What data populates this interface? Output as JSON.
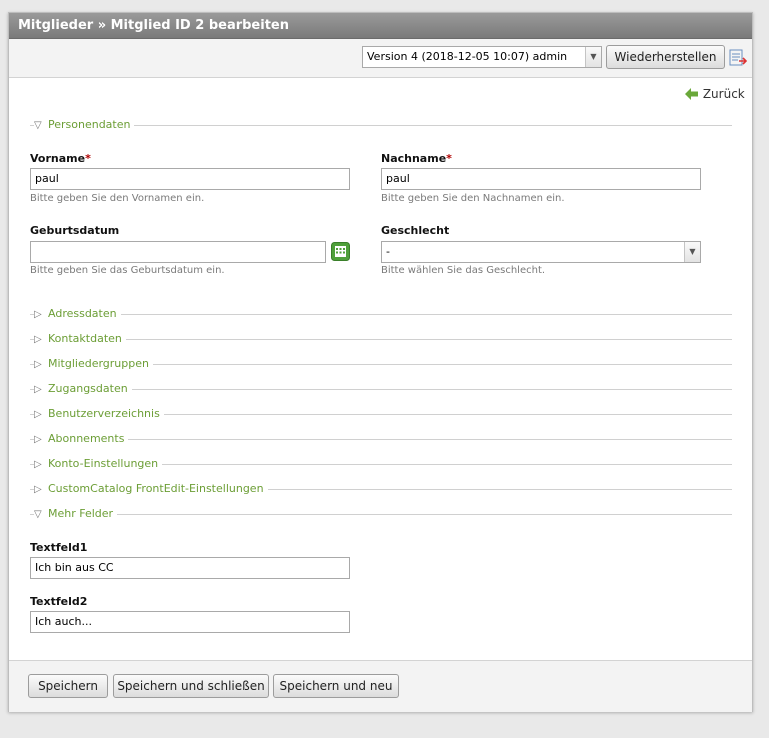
{
  "header": {
    "breadcrumb": "Mitglieder » Mitglied ID 2 bearbeiten"
  },
  "version_bar": {
    "selected_version": "Version 4 (2018-12-05 10:07) admin",
    "restore_label": "Wiederherstellen",
    "diff_icon": "compare-icon"
  },
  "back": {
    "label": "Zurück",
    "icon": "back-arrow-icon"
  },
  "personal": {
    "legend": "Personendaten",
    "firstname": {
      "label": "Vorname",
      "required": "*",
      "value": "paul",
      "hint": "Bitte geben Sie den Vornamen ein."
    },
    "lastname": {
      "label": "Nachname",
      "required": "*",
      "value": "paul",
      "hint": "Bitte geben Sie den Nachnamen ein."
    },
    "dateOfBirth": {
      "label": "Geburtsdatum",
      "value": "",
      "hint": "Bitte geben Sie das Geburtsdatum ein."
    },
    "gender": {
      "label": "Geschlecht",
      "value": "-",
      "hint": "Bitte wählen Sie das Geschlecht."
    }
  },
  "collapsed_sections": [
    "Adressdaten",
    "Kontaktdaten",
    "Mitgliedergruppen",
    "Zugangsdaten",
    "Benutzerverzeichnis",
    "Abonnements",
    "Konto-Einstellungen",
    "CustomCatalog FrontEdit-Einstellungen"
  ],
  "more_fields": {
    "legend": "Mehr Felder",
    "textfeld1": {
      "label": "Textfeld1",
      "value": "Ich bin aus CC"
    },
    "textfeld2": {
      "label": "Textfeld2",
      "value": "Ich auch..."
    }
  },
  "footer": {
    "save": "Speichern",
    "save_close": "Speichern und schließen",
    "save_new": "Speichern und neu"
  },
  "colors": {
    "accent_green": "#6c9e36",
    "required_red": "#b00000",
    "title_bg": "#8a8a8a"
  }
}
